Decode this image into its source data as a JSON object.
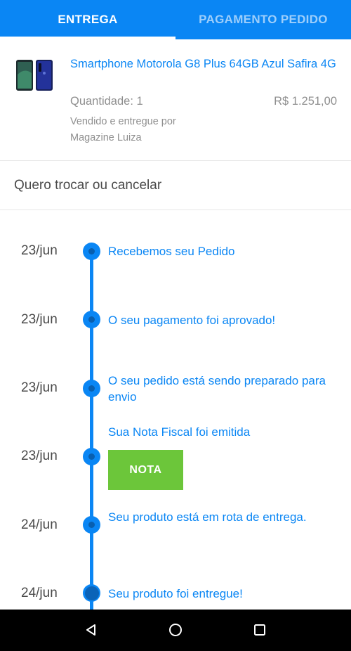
{
  "tabs": {
    "delivery": "ENTREGA",
    "payment": "PAGAMENTO PEDIDO"
  },
  "product": {
    "image_icon": "smartphone-image",
    "title": "Smartphone Motorola G8 Plus 64GB Azul Safira 4G",
    "quantity": "Quantidade: 1",
    "price": "R$ 1.251,00",
    "sold_by": "Vendido e entregue por",
    "seller": "Magazine Luiza"
  },
  "exchange": {
    "label": "Quero trocar ou cancelar"
  },
  "timeline": [
    {
      "date": "23/jun",
      "text": "Recebemos seu Pedido"
    },
    {
      "date": "23/jun",
      "text": "O seu pagamento foi aprovado!"
    },
    {
      "date": "23/jun",
      "text": "O seu pedido está sendo preparado para envio"
    },
    {
      "date": "23/jun",
      "text": "Sua Nota Fiscal foi emitida",
      "button": "NOTA"
    },
    {
      "date": "24/jun",
      "text": "Seu produto está em rota de entrega."
    },
    {
      "date": "24/jun",
      "text": "Seu produto foi entregue!"
    }
  ],
  "navbar": {
    "back_icon": "back-triangle-icon",
    "home_icon": "home-circle-icon",
    "recents_icon": "recents-square-icon"
  },
  "colors": {
    "brand_blue": "#0a86f4",
    "nota_green": "#6cc63a"
  }
}
